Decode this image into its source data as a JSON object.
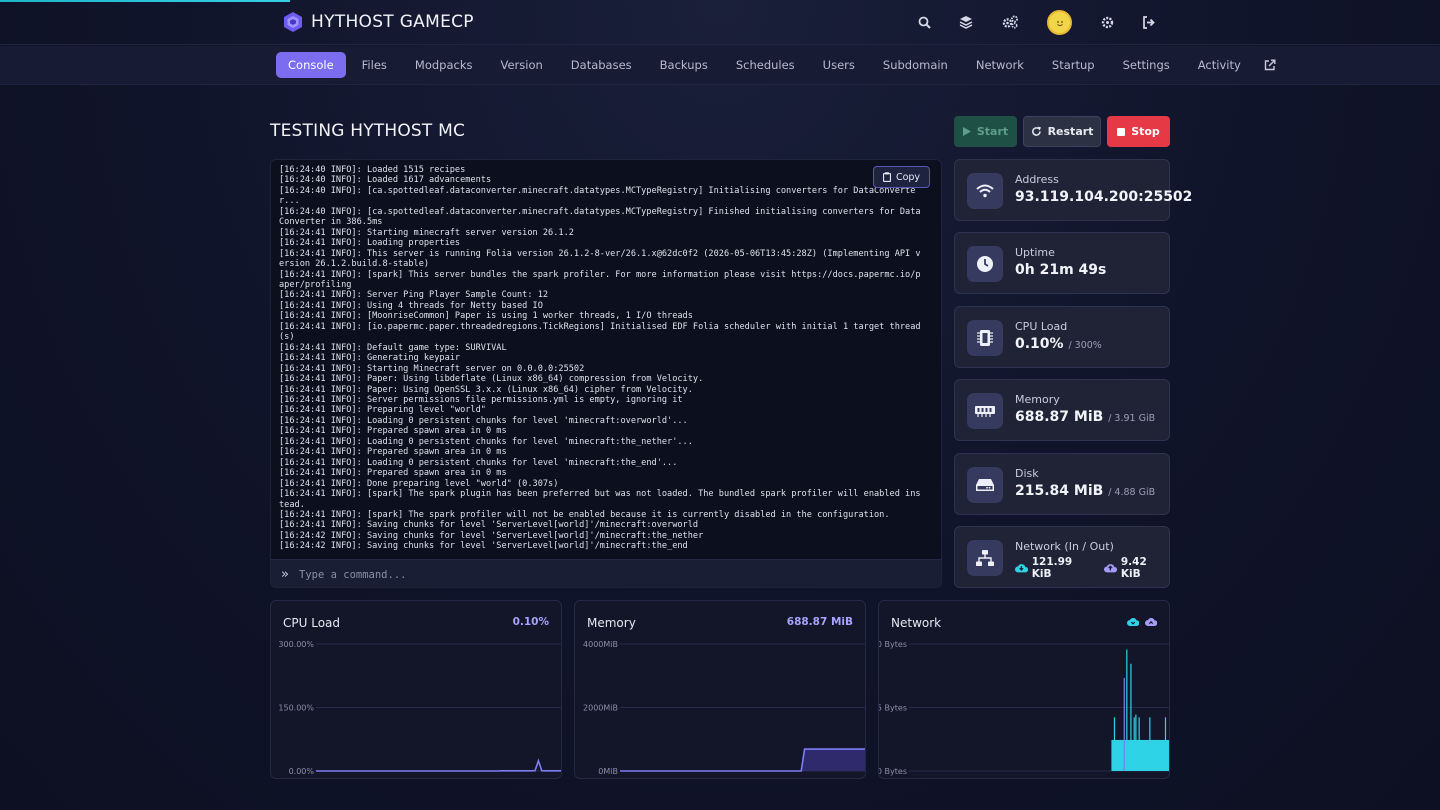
{
  "brand": {
    "name": "HYTHOST GAMECP"
  },
  "header_icons": [
    "search-icon",
    "layers-icon",
    "cogs-icon",
    "avatar",
    "gear-icon",
    "logout-icon"
  ],
  "nav": {
    "tabs": [
      {
        "label": "Console",
        "active": true
      },
      {
        "label": "Files"
      },
      {
        "label": "Modpacks"
      },
      {
        "label": "Version"
      },
      {
        "label": "Databases"
      },
      {
        "label": "Backups"
      },
      {
        "label": "Schedules"
      },
      {
        "label": "Users"
      },
      {
        "label": "Subdomain"
      },
      {
        "label": "Network"
      },
      {
        "label": "Startup"
      },
      {
        "label": "Settings"
      },
      {
        "label": "Activity"
      }
    ]
  },
  "server": {
    "title": "TESTING HYTHOST MC"
  },
  "controls": {
    "start": "Start",
    "restart": "Restart",
    "stop": "Stop"
  },
  "console": {
    "copy_label": "Copy",
    "placeholder": "Type a command...",
    "lines": [
      "[16:24:40 INFO]: Loaded 1515 recipes",
      "[16:24:40 INFO]: Loaded 1617 advancements",
      "[16:24:40 INFO]: [ca.spottedleaf.dataconverter.minecraft.datatypes.MCTypeRegistry] Initialising converters for DataConverter...",
      "[16:24:40 INFO]: [ca.spottedleaf.dataconverter.minecraft.datatypes.MCTypeRegistry] Finished initialising converters for DataConverter in 386.5ms",
      "[16:24:41 INFO]: Starting minecraft server version 26.1.2",
      "[16:24:41 INFO]: Loading properties",
      "[16:24:41 INFO]: This server is running Folia version 26.1.2-8-ver/26.1.x@62dc0f2 (2026-05-06T13:45:28Z) (Implementing API version 26.1.2.build.8-stable)",
      "[16:24:41 INFO]: [spark] This server bundles the spark profiler. For more information please visit https://docs.papermc.io/paper/profiling",
      "[16:24:41 INFO]: Server Ping Player Sample Count: 12",
      "[16:24:41 INFO]: Using 4 threads for Netty based IO",
      "[16:24:41 INFO]: [MoonriseCommon] Paper is using 1 worker threads, 1 I/O threads",
      "[16:24:41 INFO]: [io.papermc.paper.threadedregions.TickRegions] Initialised EDF Folia scheduler with initial 1 target thread(s)",
      "[16:24:41 INFO]: Default game type: SURVIVAL",
      "[16:24:41 INFO]: Generating keypair",
      "[16:24:41 INFO]: Starting Minecraft server on 0.0.0.0:25502",
      "[16:24:41 INFO]: Paper: Using libdeflate (Linux x86_64) compression from Velocity.",
      "[16:24:41 INFO]: Paper: Using OpenSSL 3.x.x (Linux x86_64) cipher from Velocity.",
      "[16:24:41 INFO]: Server permissions file permissions.yml is empty, ignoring it",
      "[16:24:41 INFO]: Preparing level \"world\"",
      "[16:24:41 INFO]: Loading 0 persistent chunks for level 'minecraft:overworld'...",
      "[16:24:41 INFO]: Prepared spawn area in 0 ms",
      "[16:24:41 INFO]: Loading 0 persistent chunks for level 'minecraft:the_nether'...",
      "[16:24:41 INFO]: Prepared spawn area in 0 ms",
      "[16:24:41 INFO]: Loading 0 persistent chunks for level 'minecraft:the_end'...",
      "[16:24:41 INFO]: Prepared spawn area in 0 ms",
      "[16:24:41 INFO]: Done preparing level \"world\" (0.307s)",
      "[16:24:41 INFO]: [spark] The spark plugin has been preferred but was not loaded. The bundled spark profiler will enabled instead.",
      "[16:24:41 INFO]: [spark] The spark profiler will not be enabled because it is currently disabled in the configuration.",
      "[16:24:41 INFO]: Saving chunks for level 'ServerLevel[world]'/minecraft:overworld",
      "[16:24:42 INFO]: Saving chunks for level 'ServerLevel[world]'/minecraft:the_nether",
      "[16:24:42 INFO]: Saving chunks for level 'ServerLevel[world]'/minecraft:the_end"
    ]
  },
  "stats": {
    "address": {
      "label": "Address",
      "value": "93.119.104.200:25502",
      "icon": "wifi-icon"
    },
    "uptime": {
      "label": "Uptime",
      "value": "0h 21m 49s",
      "icon": "clock-icon"
    },
    "cpu": {
      "label": "CPU Load",
      "value": "0.10%",
      "sub": "/ 300%",
      "icon": "cpu-icon"
    },
    "memory": {
      "label": "Memory",
      "value": "688.87 MiB",
      "sub": "/ 3.91 GiB",
      "icon": "memory-icon"
    },
    "disk": {
      "label": "Disk",
      "value": "215.84 MiB",
      "sub": "/ 4.88 GiB",
      "icon": "disk-icon"
    },
    "network": {
      "label": "Network (In / Out)",
      "in": "121.99 KiB",
      "out": "9.42 KiB",
      "icon": "network-icon"
    }
  },
  "colors": {
    "accent": "#7b6cf0",
    "stop": "#e53945",
    "cyan": "#2fd3e6",
    "purple_line": "#7f7cf6"
  },
  "chart_data": [
    {
      "type": "line",
      "title": "CPU Load",
      "current": "0.10%",
      "ytick_labels": [
        "300.00%",
        "150.00%",
        "0.00%"
      ],
      "ylim": [
        0,
        300
      ],
      "series": [
        {
          "values": [
            0,
            0,
            0,
            0,
            0,
            0,
            0,
            0,
            0,
            0,
            0,
            0,
            0,
            0,
            0,
            0,
            0,
            0,
            0,
            0,
            0,
            0,
            0,
            0,
            0,
            0,
            0,
            0,
            0,
            0,
            0,
            0,
            0,
            0,
            0,
            0,
            0,
            0,
            0,
            0,
            0,
            0,
            0,
            0,
            0,
            0,
            0,
            0,
            0,
            0,
            0,
            0,
            0,
            0,
            0,
            0.5,
            0.5,
            0.5,
            0.5,
            0.5,
            0.5,
            0.5,
            0.5,
            0.5,
            0.5,
            0.8,
            24,
            0.8,
            0.5,
            0.5,
            0.5,
            0.5,
            0.5,
            0.5
          ]
        }
      ]
    },
    {
      "type": "area",
      "title": "Memory",
      "current": "688.87 MiB",
      "ytick_labels": [
        "4000MiB",
        "2000MiB",
        "0MiB"
      ],
      "ylim": [
        0,
        4000
      ],
      "series": [
        {
          "values": [
            0,
            0,
            0,
            0,
            0,
            0,
            0,
            0,
            0,
            0,
            0,
            0,
            0,
            0,
            0,
            0,
            0,
            0,
            0,
            0,
            0,
            0,
            0,
            0,
            0,
            0,
            0,
            0,
            0,
            0,
            0,
            0,
            0,
            0,
            0,
            0,
            0,
            0,
            0,
            0,
            0,
            0,
            0,
            0,
            0,
            0,
            0,
            0,
            0,
            0,
            0,
            0,
            0,
            0,
            0,
            689,
            689,
            689,
            689,
            689,
            689,
            689,
            689,
            689,
            689,
            689,
            689,
            689,
            689,
            689,
            689,
            689,
            689,
            689
          ]
        }
      ]
    },
    {
      "type": "bar",
      "title": "Network",
      "ytick_labels": [
        "450 Bytes",
        "225 Bytes",
        "0 Bytes"
      ],
      "ylim": [
        0,
        450
      ],
      "series": [
        {
          "values": [
            0,
            0,
            0,
            0,
            0,
            0,
            0,
            0,
            0,
            0,
            0,
            0,
            0,
            0,
            0,
            0,
            0,
            0,
            0,
            0,
            0,
            0,
            0,
            0,
            0,
            0,
            0,
            0,
            0,
            0,
            0,
            0,
            0,
            0,
            0,
            0,
            0,
            0,
            0,
            0,
            0,
            0,
            0,
            0,
            0,
            0,
            0,
            0,
            0,
            0,
            0,
            0,
            0,
            0,
            0,
            0,
            0,
            0,
            0,
            0,
            0,
            0,
            0,
            0,
            0,
            0,
            0,
            0,
            0,
            0,
            0,
            0,
            0,
            0,
            0,
            0,
            0,
            0,
            0,
            0,
            0,
            0,
            0,
            0,
            0,
            0,
            0,
            0,
            0,
            0,
            0,
            0,
            0,
            0,
            0,
            0,
            0,
            0,
            0,
            0,
            0,
            0,
            0,
            0,
            0,
            0,
            0,
            0,
            0,
            0,
            0,
            0,
            0,
            0,
            0,
            0,
            0,
            0,
            0,
            0,
            0,
            0,
            0,
            0,
            0,
            0,
            0,
            0,
            0,
            0,
            0,
            0,
            0,
            0,
            0,
            0,
            0,
            0,
            0,
            0,
            0,
            0,
            0,
            0,
            0,
            0,
            0,
            0,
            0,
            0,
            0,
            0,
            0,
            0,
            0,
            0,
            0,
            0,
            0,
            0,
            0,
            0,
            0,
            0,
            0,
            0,
            0,
            0,
            0,
            0,
            0,
            0,
            0,
            0,
            0,
            0,
            0,
            0,
            0,
            0,
            0,
            0,
            0,
            0,
            0,
            0,
            0,
            0,
            0,
            0,
            0,
            0,
            0,
            0,
            0,
            0,
            0,
            0,
            0,
            0,
            0,
            0,
            0,
            0,
            0,
            0,
            0,
            0,
            0,
            0,
            0,
            0,
            0,
            0,
            0,
            0,
            0,
            0,
            0,
            0,
            0,
            0,
            0,
            0,
            0,
            0,
            0,
            0,
            0,
            0,
            0,
            0,
            0,
            0,
            0,
            0,
            0,
            0,
            0,
            0,
            0,
            0,
            0,
            0,
            0,
            0,
            110,
            110,
            110,
            190,
            110,
            110,
            110,
            110,
            110,
            110,
            110,
            110,
            110,
            110,
            110,
            110,
            110,
            110,
            430,
            110,
            110,
            110,
            110,
            380,
            110,
            110,
            110,
            190,
            110,
            200,
            110,
            110,
            110,
            190,
            110,
            110,
            110,
            110,
            110,
            110,
            110,
            110,
            110,
            110,
            110,
            110,
            190,
            110,
            110,
            110,
            110,
            110,
            110,
            110,
            110,
            110,
            110,
            110,
            110,
            110,
            110,
            110,
            110,
            110,
            110,
            190,
            110,
            110,
            110,
            110
          ]
        },
        {
          "values": [
            0,
            0,
            0,
            0,
            0,
            0,
            0,
            0,
            0,
            0,
            0,
            0,
            0,
            0,
            0,
            0,
            0,
            0,
            0,
            0,
            0,
            0,
            0,
            0,
            0,
            0,
            0,
            0,
            0,
            0,
            0,
            0,
            0,
            0,
            0,
            0,
            0,
            0,
            0,
            0,
            0,
            0,
            0,
            0,
            0,
            0,
            0,
            0,
            0,
            0,
            0,
            0,
            0,
            0,
            0,
            0,
            0,
            0,
            0,
            0,
            0,
            0,
            0,
            0,
            0,
            0,
            0,
            0,
            0,
            0,
            0,
            0,
            0,
            0,
            0,
            0,
            0,
            0,
            0,
            0,
            0,
            0,
            0,
            0,
            0,
            0,
            0,
            0,
            0,
            0,
            0,
            0,
            0,
            0,
            0,
            0,
            0,
            0,
            0,
            0,
            0,
            0,
            0,
            0,
            0,
            0,
            0,
            0,
            0,
            0,
            0,
            0,
            0,
            0,
            0,
            0,
            0,
            0,
            0,
            0,
            0,
            0,
            0,
            0,
            0,
            0,
            0,
            0,
            0,
            0,
            0,
            0,
            0,
            0,
            0,
            0,
            0,
            0,
            0,
            0,
            0,
            0,
            0,
            0,
            0,
            0,
            0,
            0,
            0,
            0,
            0,
            0,
            0,
            0,
            0,
            0,
            0,
            0,
            0,
            0,
            0,
            0,
            0,
            0,
            0,
            0,
            0,
            0,
            0,
            0,
            0,
            0,
            0,
            0,
            0,
            0,
            0,
            0,
            0,
            0,
            0,
            0,
            0,
            0,
            0,
            0,
            0,
            0,
            0,
            0,
            0,
            0,
            0,
            0,
            0,
            0,
            0,
            0,
            0,
            0,
            0,
            0,
            0,
            0,
            0,
            0,
            0,
            0,
            0,
            0,
            0,
            0,
            0,
            0,
            0,
            0,
            0,
            0,
            0,
            0,
            0,
            0,
            0,
            0,
            0,
            0,
            0,
            0,
            0,
            0,
            0,
            0,
            0,
            0,
            0,
            0,
            0,
            0,
            0,
            0,
            0,
            0,
            0,
            0,
            0,
            0,
            0,
            0,
            0,
            0,
            0,
            0,
            0,
            0,
            0,
            0,
            0,
            0,
            0,
            0,
            0,
            0,
            0,
            0,
            0,
            330,
            0,
            0,
            0,
            0,
            0,
            0,
            0,
            0,
            0,
            0,
            0,
            0,
            0,
            0,
            0,
            0,
            0,
            0,
            0,
            0,
            0,
            0,
            0,
            0,
            0,
            0,
            0,
            0,
            0,
            0,
            0,
            0,
            0,
            0,
            0,
            0,
            0,
            0,
            0,
            0,
            0,
            0,
            0,
            0,
            0,
            0,
            0,
            0,
            0,
            0,
            0,
            0,
            0,
            0,
            0
          ]
        }
      ]
    }
  ]
}
